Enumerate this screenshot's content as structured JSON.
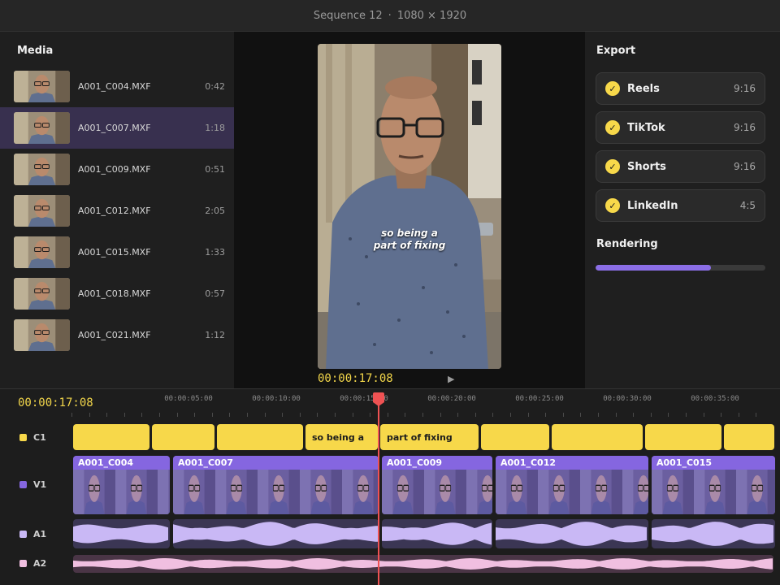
{
  "titlebar": {
    "sequence": "Sequence 12",
    "separator": "·",
    "resolution": "1080 × 1920"
  },
  "media": {
    "title": "Media",
    "items": [
      {
        "name": "A001_C004.MXF",
        "duration": "0:42",
        "selected": false
      },
      {
        "name": "A001_C007.MXF",
        "duration": "1:18",
        "selected": true
      },
      {
        "name": "A001_C009.MXF",
        "duration": "0:51",
        "selected": false
      },
      {
        "name": "A001_C012.MXF",
        "duration": "2:05",
        "selected": false
      },
      {
        "name": "A001_C015.MXF",
        "duration": "1:33",
        "selected": false
      },
      {
        "name": "A001_C018.MXF",
        "duration": "0:57",
        "selected": false
      },
      {
        "name": "A001_C021.MXF",
        "duration": "1:12",
        "selected": false
      }
    ]
  },
  "viewer": {
    "caption_lines": [
      "so being a",
      "part of fixing"
    ],
    "timecode": "00:00:17:08",
    "play_icon": "play-icon"
  },
  "export": {
    "title": "Export",
    "items": [
      {
        "name": "Reels",
        "ratio": "9:16",
        "checked": true
      },
      {
        "name": "TikTok",
        "ratio": "9:16",
        "checked": true
      },
      {
        "name": "Shorts",
        "ratio": "9:16",
        "checked": true
      },
      {
        "name": "LinkedIn",
        "ratio": "4:5",
        "checked": true
      }
    ],
    "check_glyph": "✓",
    "rendering_title": "Rendering",
    "rendering_progress": 0.68
  },
  "timeline": {
    "timecode": "00:00:17:08",
    "ruler_labels": [
      "00:00:05:00",
      "00:00:10:00",
      "00:00:15:00",
      "00:00:20:00",
      "00:00:25:00",
      "00:00:30:00",
      "00:00:35:00"
    ],
    "tracks": [
      {
        "id": "C1",
        "color": "#f7d84a"
      },
      {
        "id": "V1",
        "color": "#8566e0"
      },
      {
        "id": "A1",
        "color": "#c9b8f5"
      },
      {
        "id": "A2",
        "color": "#f0bfe0"
      }
    ],
    "caption_clips": [
      "",
      "",
      "",
      "so being a",
      "part of fixing",
      "",
      "",
      "",
      ""
    ],
    "video_clips": [
      "A001_C004",
      "A001_C007",
      "A001_C009",
      "A001_C012",
      "A001_C015"
    ]
  },
  "colors": {
    "accent_yellow": "#f7d84a",
    "accent_purple": "#8566e0",
    "playhead": "#ef5253",
    "selected_row": "#38304f"
  }
}
